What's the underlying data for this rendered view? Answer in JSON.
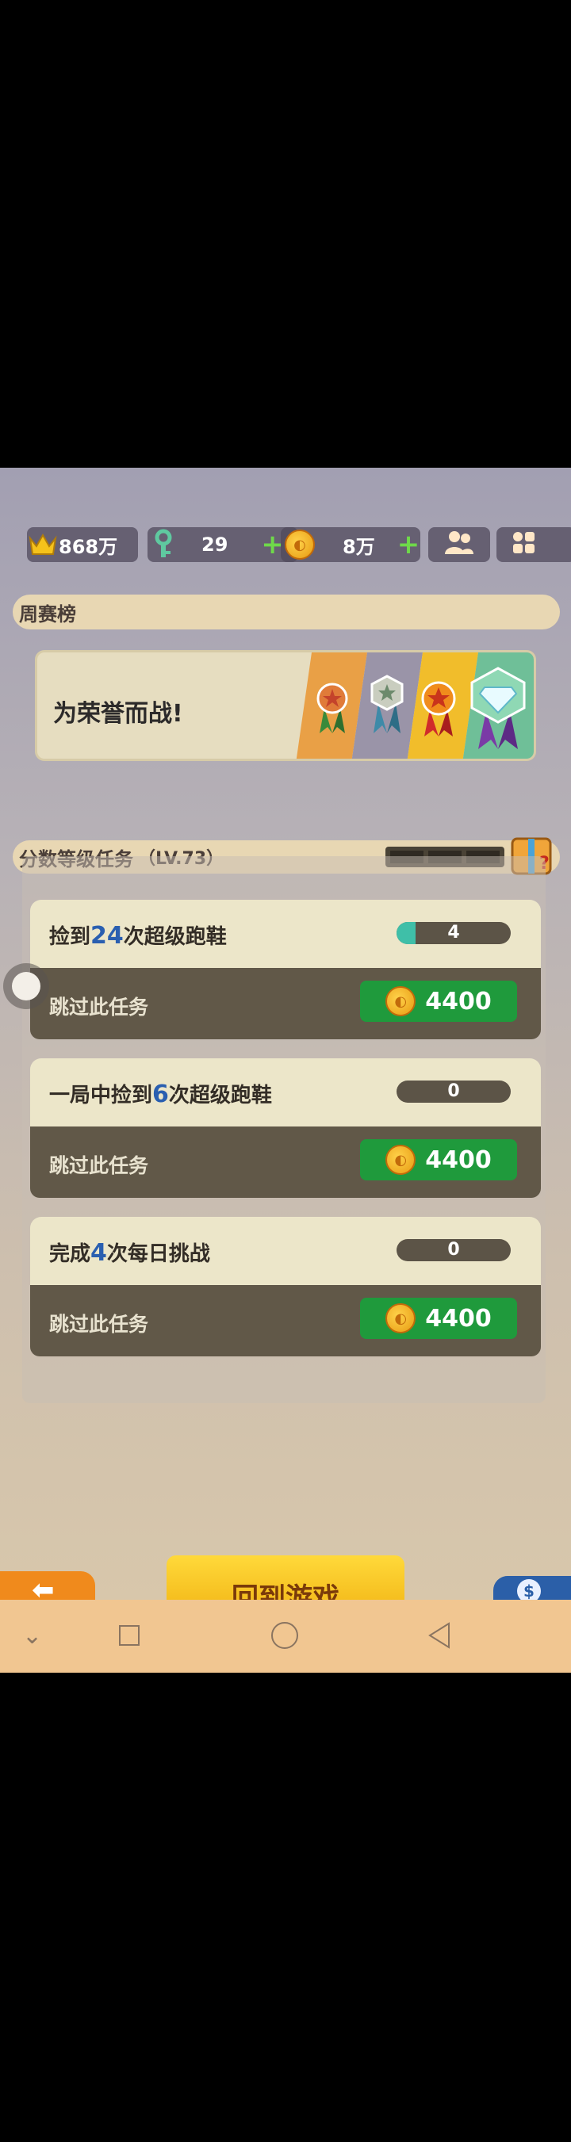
{
  "resources": {
    "crowns": "868万",
    "keys": "29",
    "coins": "8万"
  },
  "weekly": {
    "title": "周赛榜"
  },
  "honor": {
    "title": "为荣誉而战!"
  },
  "tasks_section": {
    "title": "分数等级任务",
    "level": "（LV.73）"
  },
  "tasks": [
    {
      "pre": "捡到",
      "num": "24",
      "post": "次超级跑鞋",
      "progress": 4,
      "goal": 24,
      "progress_label": "4",
      "skip": "跳过此任务",
      "cost": "4400"
    },
    {
      "pre": "一局中捡到",
      "num": "6",
      "post": "次超级跑鞋",
      "progress": 0,
      "goal": 6,
      "progress_label": "0",
      "skip": "跳过此任务",
      "cost": "4400"
    },
    {
      "pre": "完成",
      "num": "4",
      "post": "次每日挑战",
      "progress": 0,
      "goal": 4,
      "progress_label": "0",
      "skip": "跳过此任务",
      "cost": "4400"
    }
  ],
  "bottom": {
    "back_game": "回到游戏"
  },
  "colors": {
    "accent_green": "#1f9a3c",
    "progress_fill": "#3fbfa8",
    "number_blue": "#2a5fb0"
  }
}
